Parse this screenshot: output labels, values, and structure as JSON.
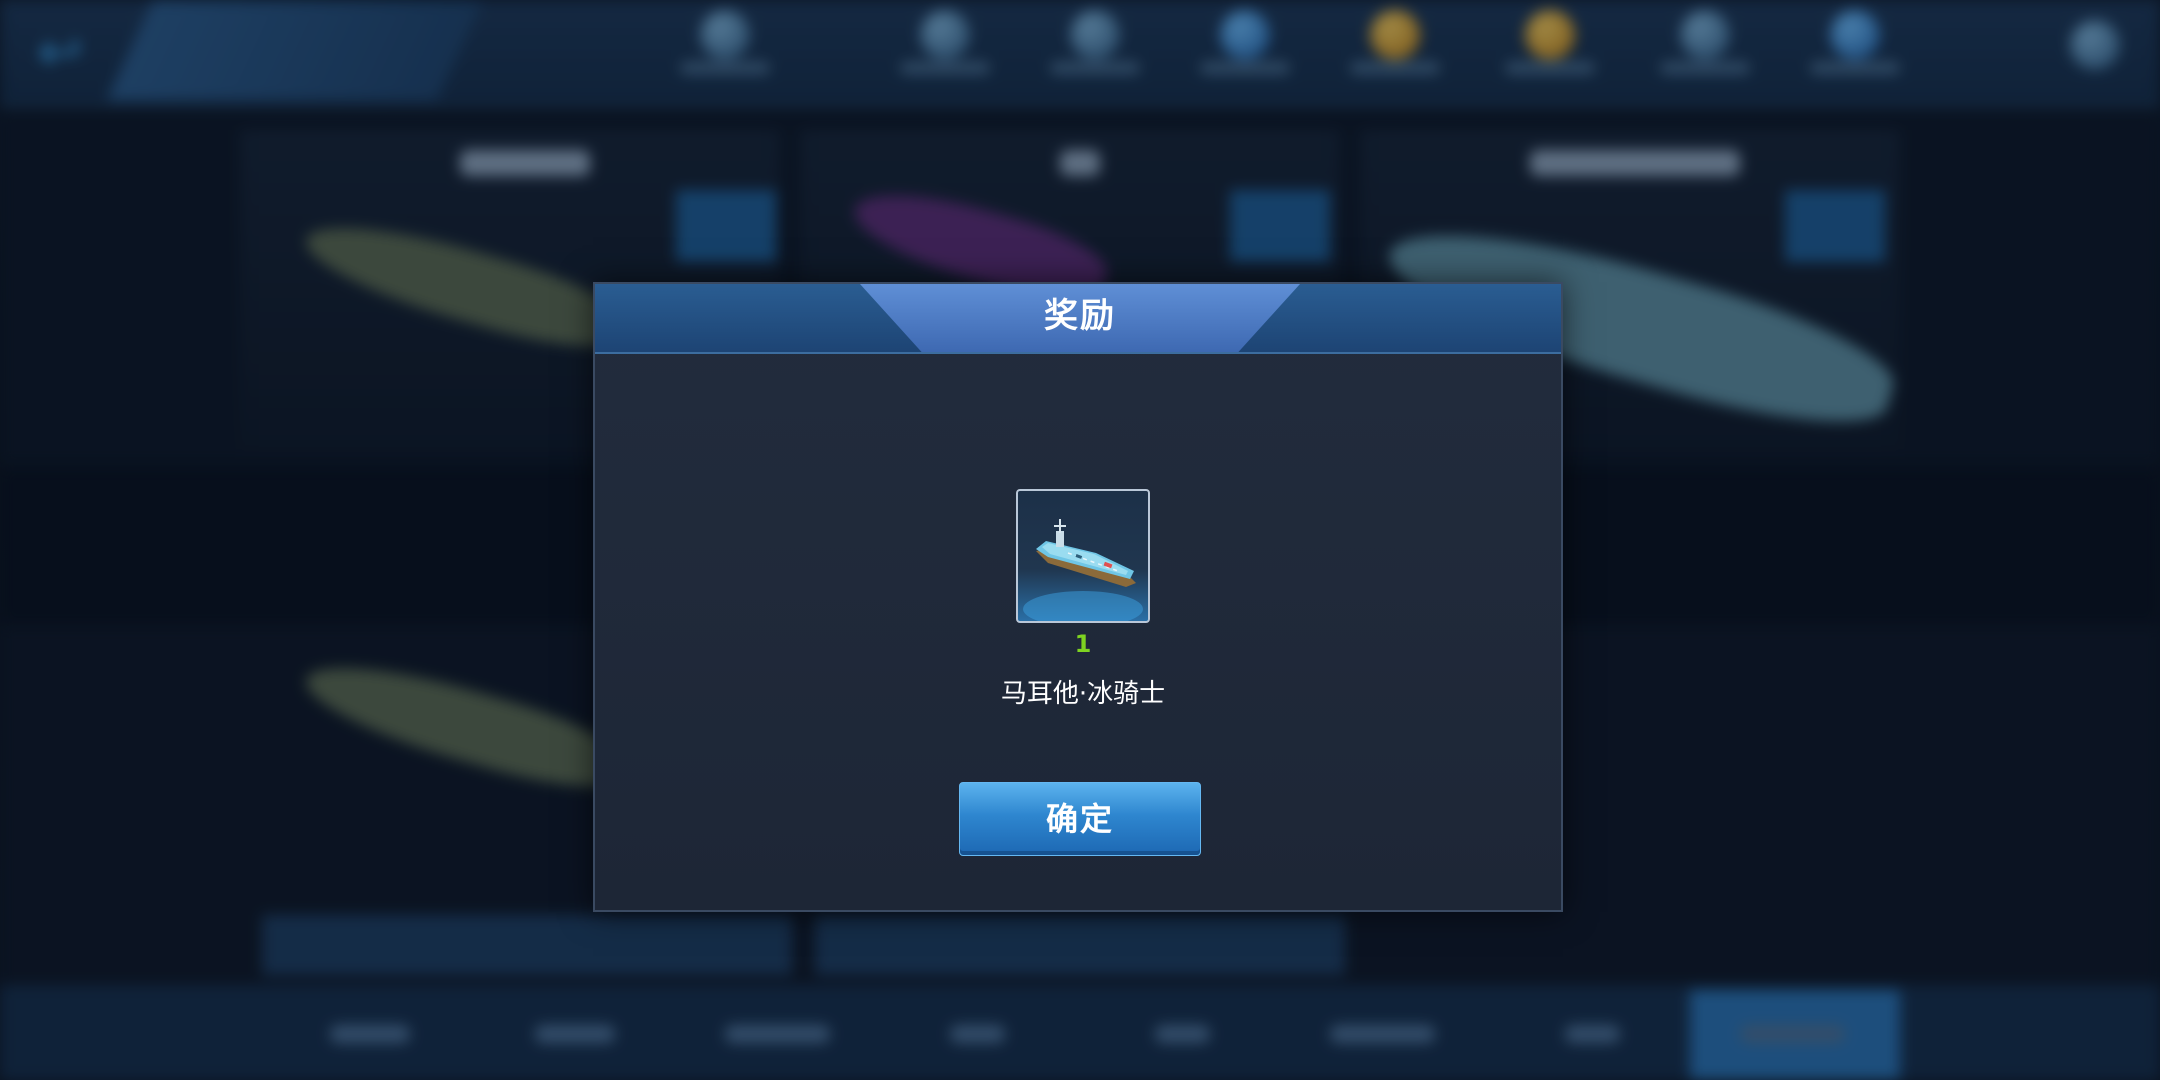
{
  "modal": {
    "title": "奖励",
    "reward": {
      "item_icon": "aircraft-carrier-icon",
      "quantity": "1",
      "name": "马耳他·冰骑士"
    },
    "confirm_label": "确定"
  },
  "colors": {
    "accent": "#2e86cf",
    "quantity": "#7ed321",
    "header": "#2a5d92"
  }
}
